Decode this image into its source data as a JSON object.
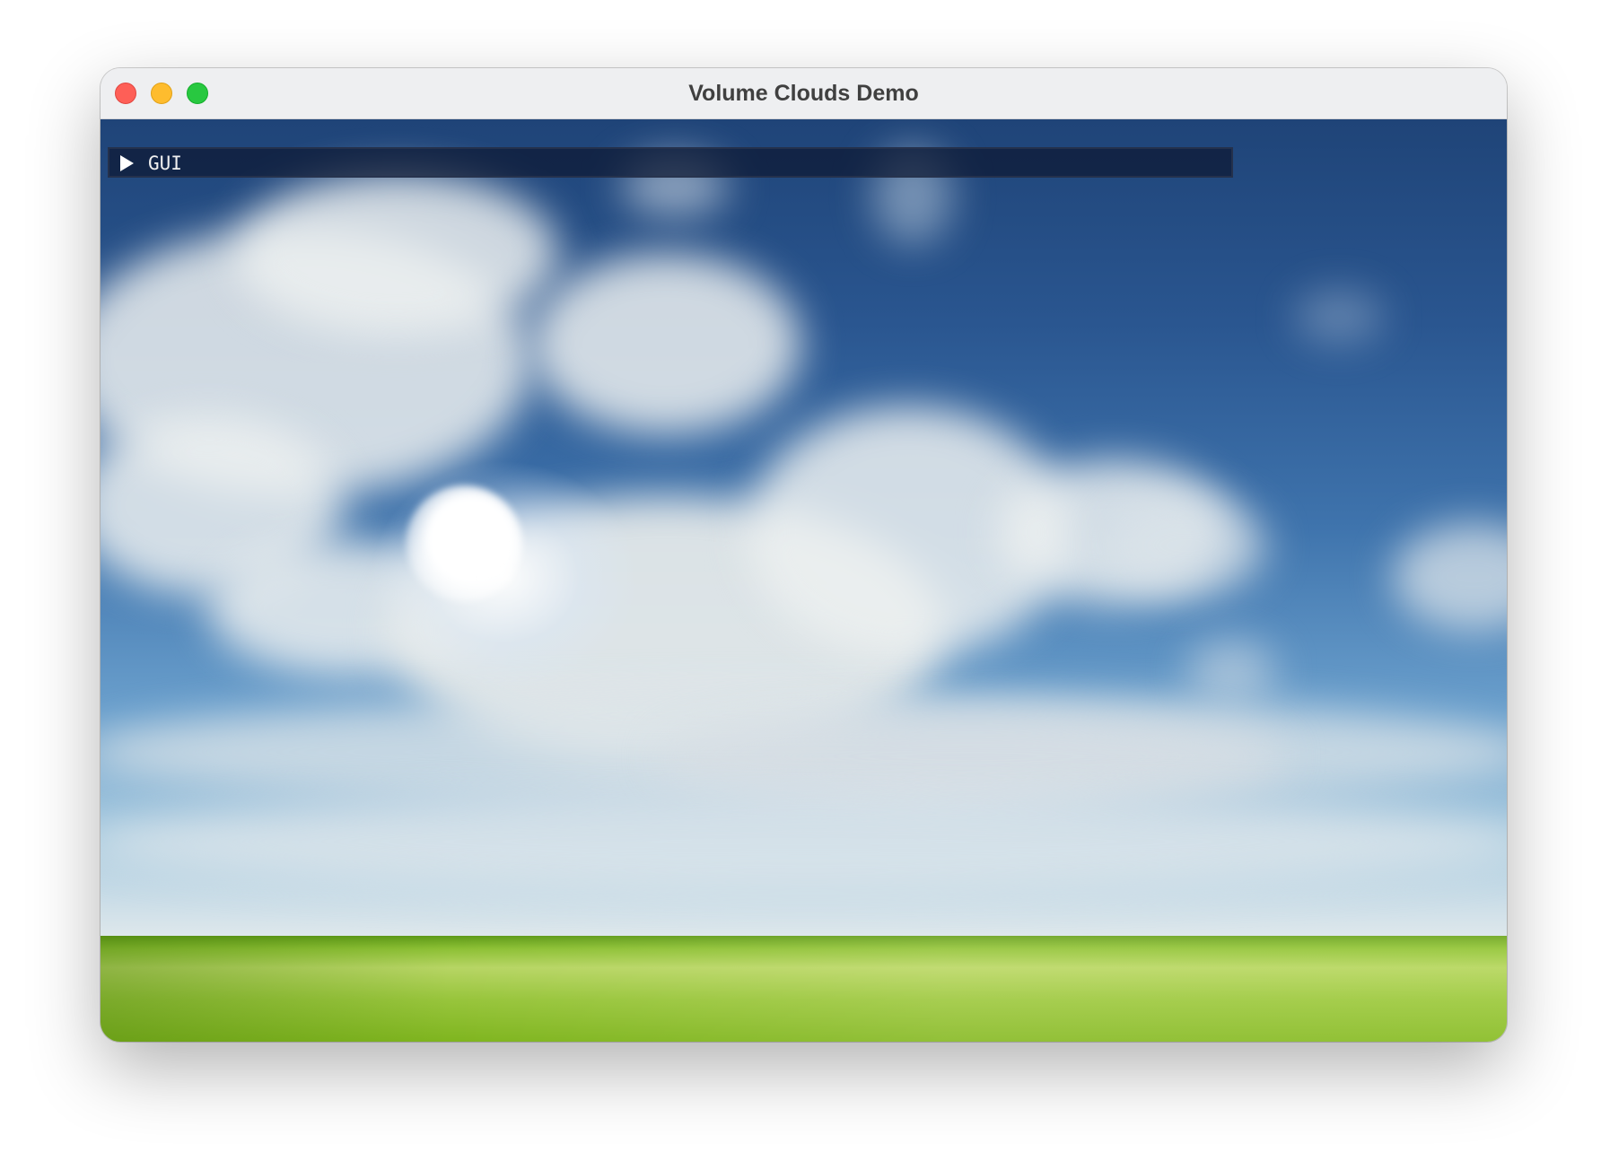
{
  "window": {
    "title": "Volume Clouds Demo",
    "controls": [
      "close",
      "minimize",
      "zoom"
    ],
    "colors": {
      "close": "#fe5f57",
      "minimize": "#febc2e",
      "zoom": "#28c840"
    }
  },
  "gui_panel": {
    "label": "GUI",
    "icon": "play-triangle-icon",
    "state": "collapsed"
  },
  "scene": {
    "description_colors": {
      "sky_top": "#1f4478",
      "sky_horizon": "#dfe8ec",
      "ground": "#8cc034"
    }
  }
}
